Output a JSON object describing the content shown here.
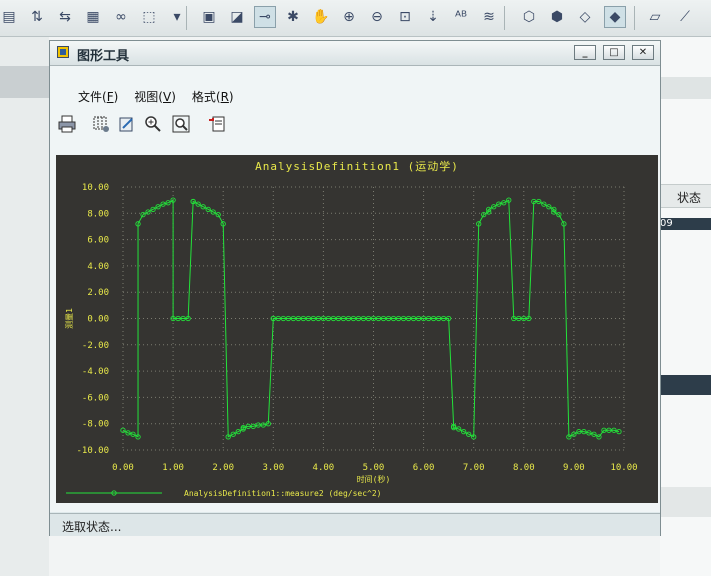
{
  "toolbar": {
    "icons": [
      "layers-icon",
      "regen-icon",
      "regen-list-icon",
      "grid-icon",
      "binoculars-icon",
      "select-box-icon",
      "chevron-down-icon",
      "saved-view-icon",
      "edit-view-icon",
      "datum-point-icon",
      "spin-center-icon",
      "pan-hand-icon",
      "zoom-in-icon",
      "zoom-out-icon",
      "refit-icon",
      "reorient-icon",
      "annotation-icon",
      "layers-stack-icon",
      "wireframe-icon",
      "hidden-line-icon",
      "no-hidden-icon",
      "shaded-icon",
      "datum-plane-icon",
      "datum-axis-icon"
    ]
  },
  "dialog": {
    "title": "图形工具",
    "controls": {
      "minimize": "_",
      "maximize": "□",
      "close": "✕"
    },
    "menu": [
      {
        "label": "文件(",
        "key": "F",
        "close": ")"
      },
      {
        "label": "视图(",
        "key": "V",
        "close": ")"
      },
      {
        "label": "格式(",
        "key": "R",
        "close": ")"
      }
    ],
    "status": "选取状态..."
  },
  "background": {
    "status_header": "状态",
    "cell_text": "09"
  },
  "chart_data": {
    "type": "line",
    "title": "AnalysisDefinition1 (运动学)",
    "xlabel": "时间(秒)",
    "ylabel": "测量1",
    "xlim": [
      0,
      10
    ],
    "ylim": [
      -10,
      10
    ],
    "x_ticks": [
      "0.00",
      "1.00",
      "2.00",
      "3.00",
      "4.00",
      "5.00",
      "6.00",
      "7.00",
      "8.00",
      "9.00",
      "10.00"
    ],
    "y_ticks": [
      "10.00",
      "8.00",
      "6.00",
      "4.00",
      "2.00",
      "0.00",
      "-2.00",
      "-4.00",
      "-6.00",
      "-8.00",
      "-10.00"
    ],
    "grid": true,
    "legend_position": "bottom-left",
    "colors": {
      "background": "#353431",
      "series": "#23e23a",
      "text": "#e8e84a",
      "grid": "#7b7b70"
    },
    "series": [
      {
        "name": "AnalysisDefinition1::measure2 (deg/sec^2)",
        "x": [
          0.0,
          0.1,
          0.2,
          0.3,
          0.3,
          0.4,
          0.5,
          0.6,
          0.7,
          0.8,
          0.9,
          1.0,
          1.0,
          1.1,
          1.2,
          1.3,
          1.4,
          1.4,
          1.5,
          1.6,
          1.7,
          1.8,
          1.9,
          2.0,
          2.1,
          2.2,
          2.3,
          2.4,
          2.4,
          2.5,
          2.6,
          2.7,
          2.8,
          2.9,
          3.0,
          3.0,
          3.1,
          3.2,
          3.3,
          3.4,
          3.5,
          3.6,
          3.7,
          3.8,
          3.9,
          4.0,
          4.1,
          4.2,
          4.3,
          4.4,
          4.5,
          4.6,
          4.7,
          4.8,
          4.9,
          5.0,
          5.1,
          5.2,
          5.3,
          5.4,
          5.5,
          5.6,
          5.7,
          5.8,
          5.9,
          6.0,
          6.1,
          6.2,
          6.3,
          6.4,
          6.5,
          6.6,
          6.6,
          6.7,
          6.8,
          6.9,
          7.0,
          7.1,
          7.2,
          7.3,
          7.3,
          7.4,
          7.5,
          7.6,
          7.7,
          7.8,
          7.9,
          8.0,
          8.1,
          8.2,
          8.3,
          8.4,
          8.5,
          8.6,
          8.6,
          8.7,
          8.8,
          8.9,
          9.0,
          9.1,
          9.2,
          9.3,
          9.4,
          9.5,
          9.6,
          9.7,
          9.8,
          9.9
        ],
        "y": [
          -8.5,
          -8.7,
          -8.8,
          -9.0,
          7.2,
          7.9,
          8.1,
          8.3,
          8.5,
          8.7,
          8.8,
          9.0,
          0.0,
          0.0,
          0.0,
          0.0,
          8.9,
          8.9,
          8.7,
          8.5,
          8.3,
          8.1,
          7.9,
          7.2,
          -9.0,
          -8.8,
          -8.6,
          -8.4,
          -8.3,
          -8.2,
          -8.2,
          -8.1,
          -8.1,
          -8.0,
          0.0,
          0.0,
          0.0,
          0.0,
          0.0,
          0.0,
          0.0,
          0.0,
          0.0,
          0.0,
          0.0,
          0.0,
          0.0,
          0.0,
          0.0,
          0.0,
          0.0,
          0.0,
          0.0,
          0.0,
          0.0,
          0.0,
          0.0,
          0.0,
          0.0,
          0.0,
          0.0,
          0.0,
          0.0,
          0.0,
          0.0,
          0.0,
          0.0,
          0.0,
          0.0,
          0.0,
          0.0,
          -8.2,
          -8.3,
          -8.4,
          -8.6,
          -8.8,
          -9.0,
          7.2,
          7.9,
          8.1,
          8.3,
          8.5,
          8.7,
          8.8,
          9.0,
          0.0,
          0.0,
          0.0,
          0.0,
          8.9,
          8.9,
          8.7,
          8.5,
          8.3,
          8.1,
          7.9,
          7.2,
          -9.0,
          -8.8,
          -8.6,
          -8.6,
          -8.7,
          -8.8,
          -9.0,
          -8.5,
          -8.5,
          -8.5,
          -8.6
        ]
      }
    ]
  }
}
